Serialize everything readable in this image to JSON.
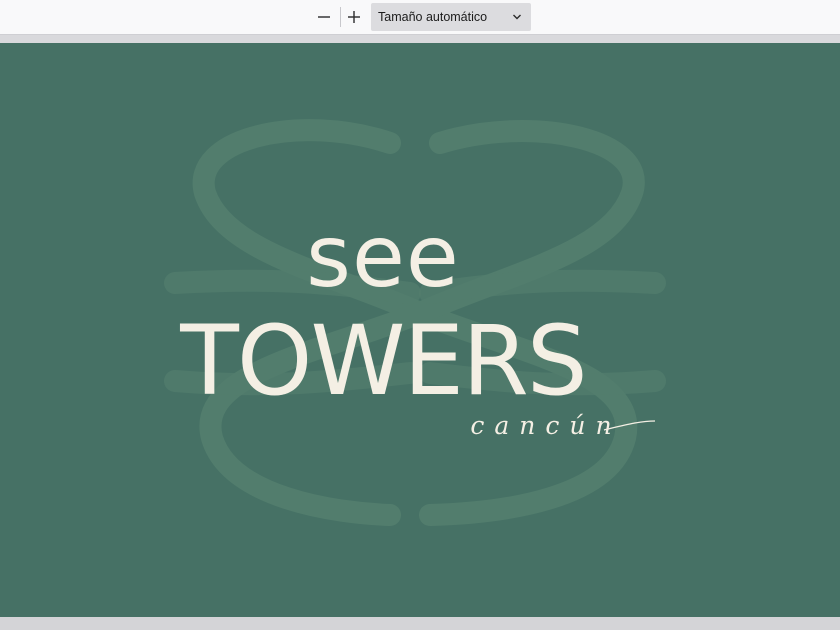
{
  "toolbar": {
    "zoom_out_icon": "minus-icon",
    "zoom_in_icon": "plus-icon",
    "zoom_value": "Tamaño automático",
    "dropdown_icon": "chevron-down-icon"
  },
  "document": {
    "background_color": "#467165",
    "text_color": "#f4efe4",
    "logo_text": [
      "see",
      "TOWERS",
      "cancún"
    ],
    "watermark": "monogram-watermark"
  }
}
